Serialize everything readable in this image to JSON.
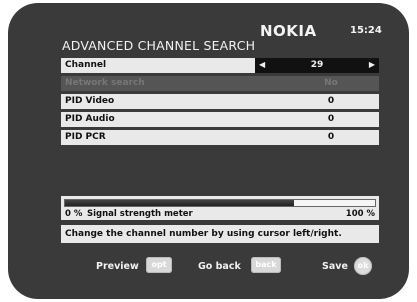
{
  "header": {
    "title": "ADVANCED CHANNEL SEARCH",
    "brand": "NOKIA",
    "time": "15:24"
  },
  "menu": {
    "items": [
      {
        "label": "Channel",
        "value": "29",
        "type": "selector",
        "selected": true
      },
      {
        "label": "Network search",
        "value": "No",
        "type": "value",
        "disabled": true
      },
      {
        "label": "PID Video",
        "value": "0",
        "type": "value"
      },
      {
        "label": "PID Audio",
        "value": "0",
        "type": "value"
      },
      {
        "label": "PID PCR",
        "value": "0",
        "type": "value"
      }
    ]
  },
  "signal": {
    "min_label": "0 %",
    "caption": "Signal strength meter",
    "max_label": "100 %",
    "level_percent": 74
  },
  "hint": "Change the channel number by using cursor left/right.",
  "footer": {
    "preview_label": "Preview",
    "preview_key": "opt",
    "back_label": "Go back",
    "back_key": "back",
    "save_label": "Save",
    "save_key": "ok"
  }
}
